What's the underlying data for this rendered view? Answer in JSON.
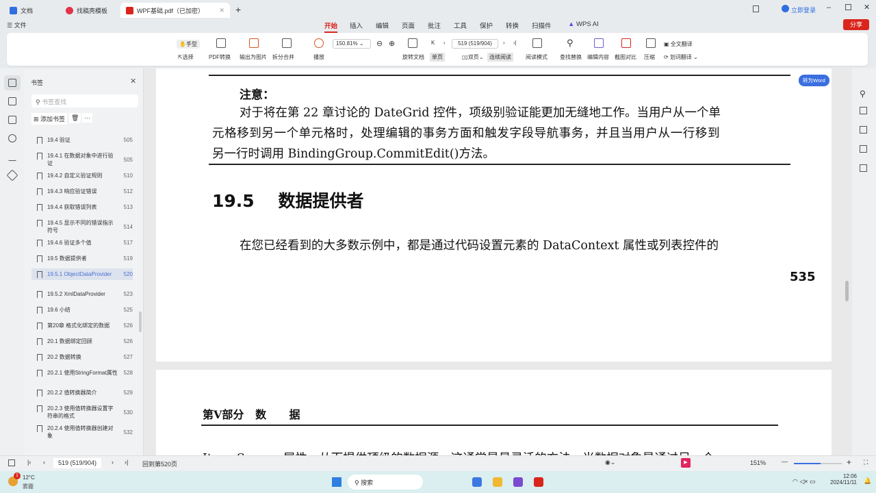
{
  "tabs": [
    {
      "label": "文档",
      "color": "#2f6fe0"
    },
    {
      "label": "找稿壳模板",
      "color": "#e0354a"
    },
    {
      "label": "WPF基础.pdf（已加密）",
      "color": "#d9251c"
    }
  ],
  "window": {
    "login": "立即登录",
    "share": "分享"
  },
  "menu": {
    "file": "文件",
    "items": [
      "开始",
      "插入",
      "编辑",
      "页面",
      "批注",
      "工具",
      "保护",
      "转换",
      "扫描件"
    ],
    "ai": "WPS AI"
  },
  "ribbon": {
    "hand": "手型",
    "select": "选择",
    "pdf_convert": "PDF转换",
    "export_image": "输出为图片",
    "split_merge": "拆分合并",
    "play": "播放",
    "zoom": "150.81%",
    "rotate": "旋转文档",
    "single": "单页",
    "double": "双页",
    "continuous": "连续阅读",
    "page_input": "519 (519/904)",
    "read_mode": "阅读模式",
    "find": "查找替换",
    "edit": "编辑内容",
    "compare": "截图对比",
    "compress": "压缩",
    "translate_all": "全文翻译",
    "translate_word": "划词翻译"
  },
  "sidebar": {
    "title": "书签",
    "search_placeholder": "书签查找",
    "add": "添加书签",
    "more": "···",
    "items": [
      {
        "label": "19.4 验证",
        "page": "505"
      },
      {
        "label": "19.4.1 在数据对象中进行验证",
        "page": "505",
        "two": true
      },
      {
        "label": "19.4.2 自定义验证规则",
        "page": "510"
      },
      {
        "label": "19.4.3 响应验证错误",
        "page": "512"
      },
      {
        "label": "19.4.4 获取错误列表",
        "page": "513"
      },
      {
        "label": "19.4.5 显示不同的错误指示符号",
        "page": "514",
        "two": true
      },
      {
        "label": "19.4.6 验证多个值",
        "page": "517"
      },
      {
        "label": "19.5 数据提供者",
        "page": "519"
      },
      {
        "label": "19.5.1 ObjectDataProvider",
        "page": "520",
        "two": true,
        "selected": true
      },
      {
        "label": "19.5.2 XmlDataProvider",
        "page": "523"
      },
      {
        "label": "19.6 小结",
        "page": "525"
      },
      {
        "label": "第20章 格式化绑定的数据",
        "page": "526"
      },
      {
        "label": "20.1 数据绑定回顾",
        "page": "526"
      },
      {
        "label": "20.2 数据转换",
        "page": "527"
      },
      {
        "label": "20.2.1 使用StringFormat属性",
        "page": "528",
        "two": true
      },
      {
        "label": "20.2.2 值转换器简介",
        "page": "529"
      },
      {
        "label": "20.2.3 使用值转换器设置字符串的格式",
        "page": "530",
        "two": true
      },
      {
        "label": "20.2.4 使用值转换器创建对象",
        "page": "532",
        "two": true
      }
    ]
  },
  "page1": {
    "note_title": "注意：",
    "note_lines": [
      "对于将在第 22 章讨论的 DateGrid 控件，项级别验证能更加无缝地工作。当用户从一个单",
      "元格移到另一个单元格时，处理编辑的事务方面和触发字段导航事务，并且当用户从一行移到",
      "另一行时调用 BindingGroup.CommitEdit()方法。"
    ],
    "heading": "19.5    数据提供者",
    "para": "在您已经看到的大多数示例中，都是通过代码设置元素的 DataContext 属性或列表控件的",
    "page_number": "535"
  },
  "page2": {
    "header": "第Ⅴ部分   数      据",
    "para": "ItemsSource 属性，从而提供顶级的数据源。这通常是最灵活的方法，当数据对象是通过另一个"
  },
  "to_word": "转为Word",
  "status": {
    "page_input": "519 (519/904)",
    "back": "回到第520页",
    "zoom": "151%",
    "zoom_fraction": 0.55
  },
  "taskbar": {
    "temp": "12°C",
    "weather": "雾霾",
    "search": "搜索",
    "time": "12:06",
    "date": "2024/11/11",
    "badge": "1"
  }
}
